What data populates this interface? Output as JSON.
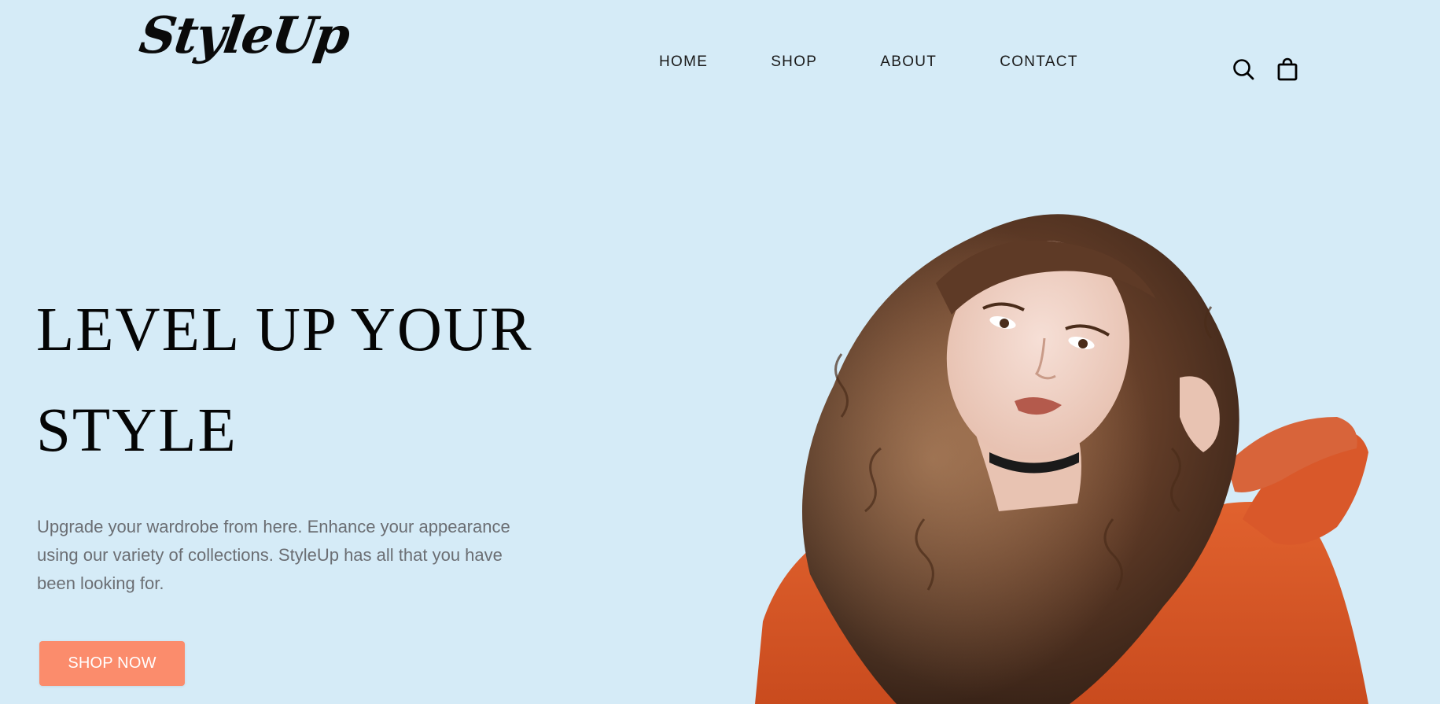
{
  "brand": {
    "logo_text": "StyleUp"
  },
  "nav": {
    "items": [
      {
        "label": "HOME"
      },
      {
        "label": "SHOP"
      },
      {
        "label": "ABOUT"
      },
      {
        "label": "CONTACT"
      }
    ]
  },
  "header_icons": {
    "search": "search-icon",
    "cart": "shopping-bag-icon"
  },
  "hero": {
    "title_line1": "LEVEL UP YOUR",
    "title_line2": "STYLE",
    "description": "Upgrade your wardrobe from here. Enhance your appearance using our variety of collections. StyleUp has all that you have been looking for.",
    "cta_label": "SHOP NOW"
  },
  "colors": {
    "background": "#d5ebf7",
    "accent": "#fb8c6c",
    "text_primary": "#050505",
    "text_muted": "#6b6e73"
  }
}
